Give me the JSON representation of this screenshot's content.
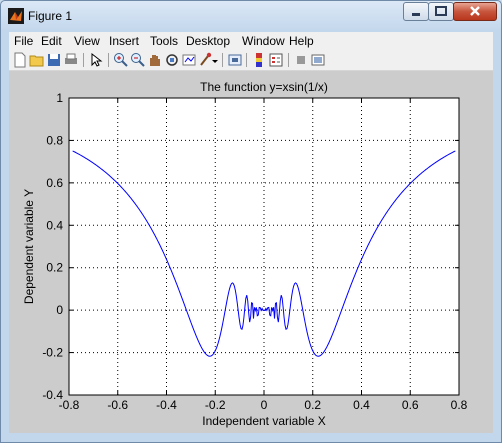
{
  "window": {
    "title": "Figure 1",
    "menu": [
      "File",
      "Edit",
      "View",
      "Insert",
      "Tools",
      "Desktop",
      "Window",
      "Help"
    ],
    "toolbar_icons": [
      "new-figure-icon",
      "open-file-icon",
      "save-icon",
      "print-icon",
      "pointer-icon",
      "zoom-in-icon",
      "zoom-out-icon",
      "pan-icon",
      "rotate-3d-icon",
      "data-cursor-icon",
      "brush-icon",
      "link-plot-icon",
      "insert-colorbar-icon",
      "insert-legend-icon",
      "hide-plot-tools-icon",
      "show-plot-tools-icon"
    ]
  },
  "chart_data": {
    "type": "line",
    "title": "The function y=xsin(1/x)",
    "xlabel": "Independent variable X",
    "ylabel": "Dependent variable Y",
    "xlim": [
      -0.8,
      0.8
    ],
    "ylim": [
      -0.4,
      1
    ],
    "xticks": [
      "-0.8",
      "-0.6",
      "-0.4",
      "-0.2",
      "0",
      "0.2",
      "0.4",
      "0.6",
      "0.8"
    ],
    "yticks": [
      "-0.4",
      "-0.2",
      "0",
      "0.2",
      "0.4",
      "0.6",
      "0.8",
      "1"
    ],
    "grid": true,
    "line_color": "#0000ff",
    "series": [
      {
        "function": "x*sin(1/x)",
        "x_range": [
          -0.785,
          0.785
        ]
      }
    ]
  }
}
